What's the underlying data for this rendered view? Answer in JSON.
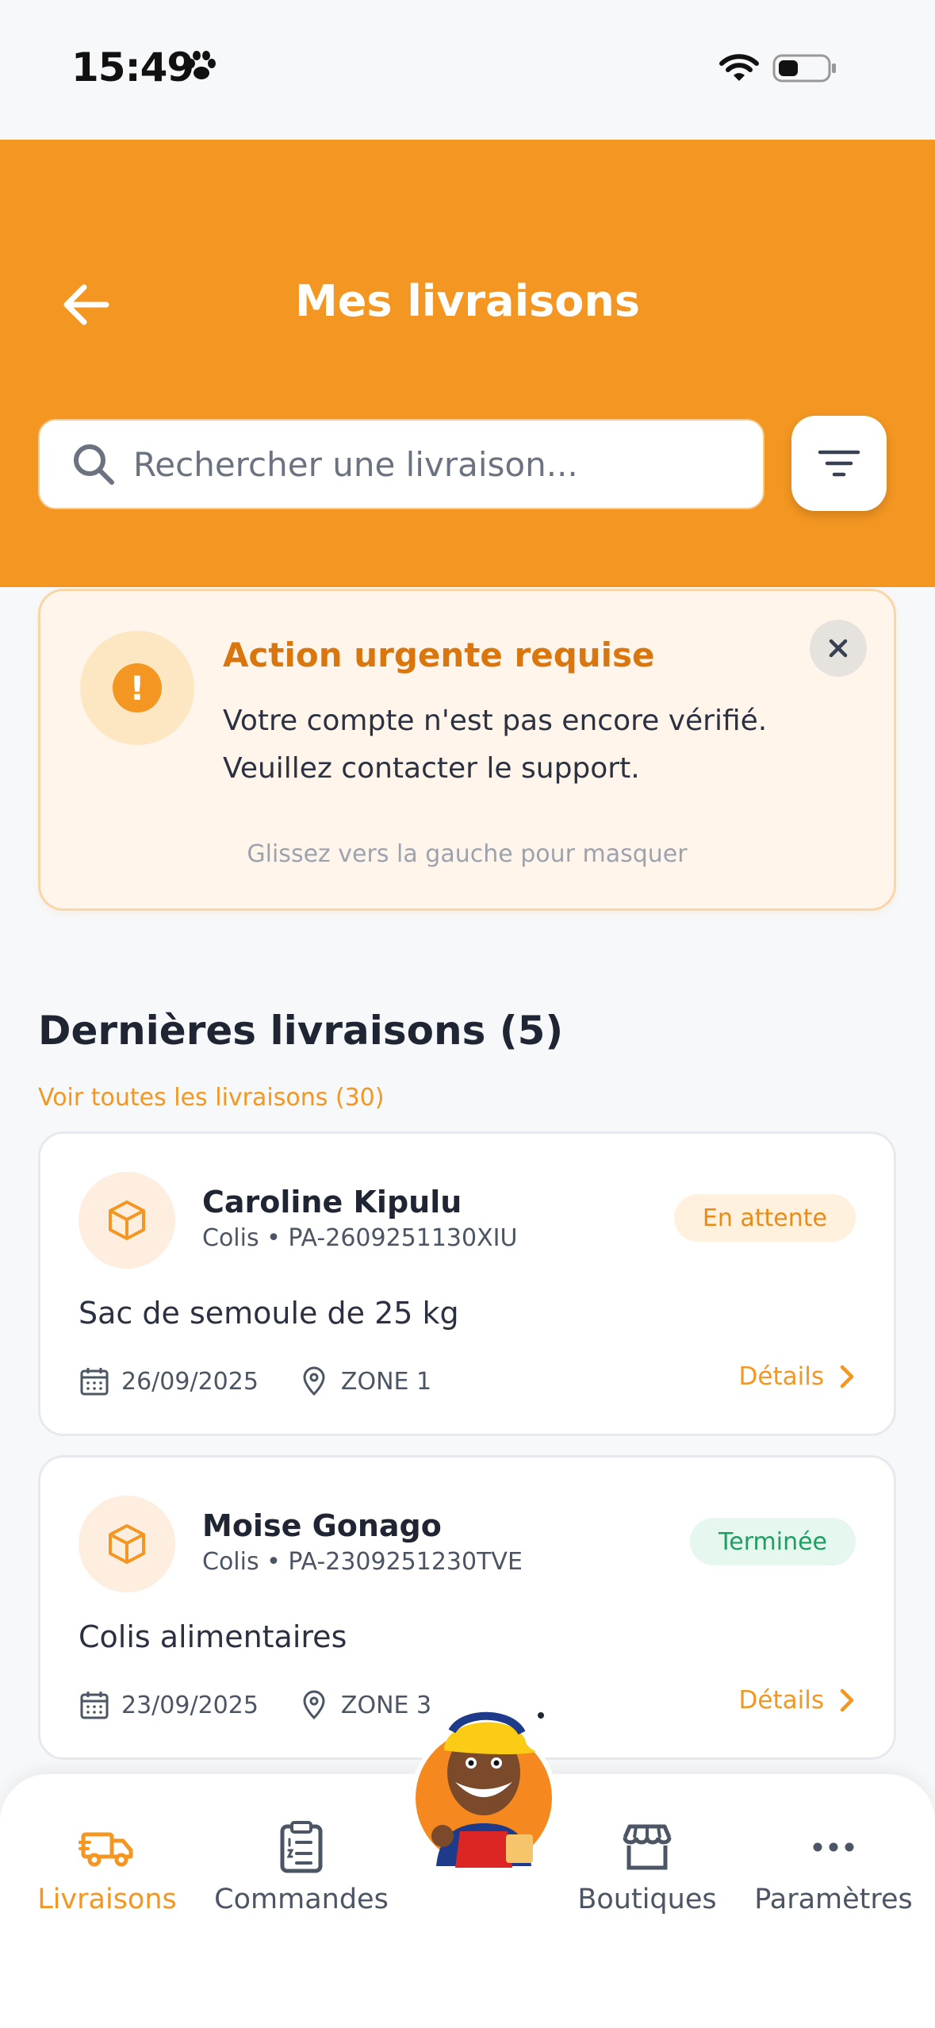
{
  "status_bar": {
    "time": "15:49"
  },
  "header": {
    "title": "Mes livraisons",
    "search_placeholder": "Rechercher une livraison..."
  },
  "alert": {
    "title": "Action urgente requise",
    "message_line1": "Votre compte n'est pas encore vérifié.",
    "message_line2": "Veuillez contacter le support.",
    "hint": "Glissez vers la gauche pour masquer"
  },
  "section": {
    "title": "Dernières livraisons (5)",
    "see_all": "Voir toutes les livraisons (30)"
  },
  "deliveries": [
    {
      "name": "Caroline Kipulu",
      "subtitle": "Colis • PA-2609251130XIU",
      "status": "En attente",
      "description": "Sac de semoule de 25 kg",
      "date": "26/09/2025",
      "zone": "ZONE 1",
      "details_label": "Détails"
    },
    {
      "name": "Moise Gonago",
      "subtitle": "Colis • PA-2309251230TVE",
      "status": "Terminée",
      "description": "Colis alimentaires",
      "date": "23/09/2025",
      "zone": "ZONE 3",
      "details_label": "Détails"
    }
  ],
  "bottom_nav": {
    "items": [
      {
        "label": "Livraisons",
        "icon": "truck-icon",
        "active": true
      },
      {
        "label": "Commandes",
        "icon": "clipboard-list-icon",
        "active": false
      },
      {
        "label": "Boutiques",
        "icon": "store-icon",
        "active": false
      },
      {
        "label": "Paramètres",
        "icon": "more-dots-icon",
        "active": false
      }
    ]
  },
  "colors": {
    "primary": "#f39622",
    "pending_badge_bg": "#fff1de",
    "done_badge_bg": "#e5f7ee",
    "done_badge_text": "#1f9d63"
  }
}
